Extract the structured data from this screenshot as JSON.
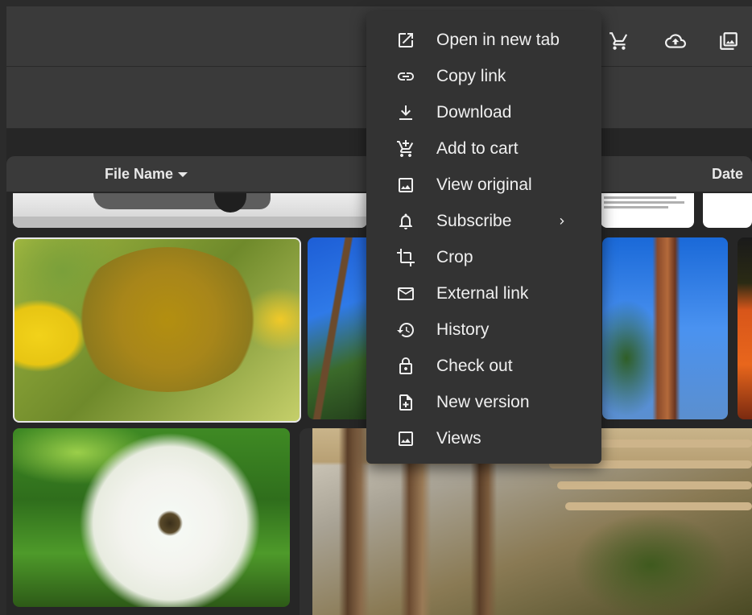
{
  "grid_header": {
    "file_name_label": "File Name",
    "date_label": "Date M"
  },
  "top_icons": [
    "cart-icon",
    "cloud-upload-icon",
    "gallery-icon"
  ],
  "context_menu": {
    "items": [
      {
        "label": "Open in new tab",
        "icon": "open-in-new-icon"
      },
      {
        "label": "Copy link",
        "icon": "link-icon"
      },
      {
        "label": "Download",
        "icon": "download-icon"
      },
      {
        "label": "Add to cart",
        "icon": "add-to-cart-icon"
      },
      {
        "label": "View original",
        "icon": "image-icon"
      },
      {
        "label": "Subscribe",
        "icon": "bell-icon",
        "submenu": true
      },
      {
        "label": "Crop",
        "icon": "crop-icon"
      },
      {
        "label": "External link",
        "icon": "mail-icon"
      },
      {
        "label": "History",
        "icon": "history-icon"
      },
      {
        "label": "Check out",
        "icon": "lock-open-icon"
      },
      {
        "label": "New version",
        "icon": "file-plus-icon"
      },
      {
        "label": "Views",
        "icon": "image-icon"
      }
    ]
  }
}
